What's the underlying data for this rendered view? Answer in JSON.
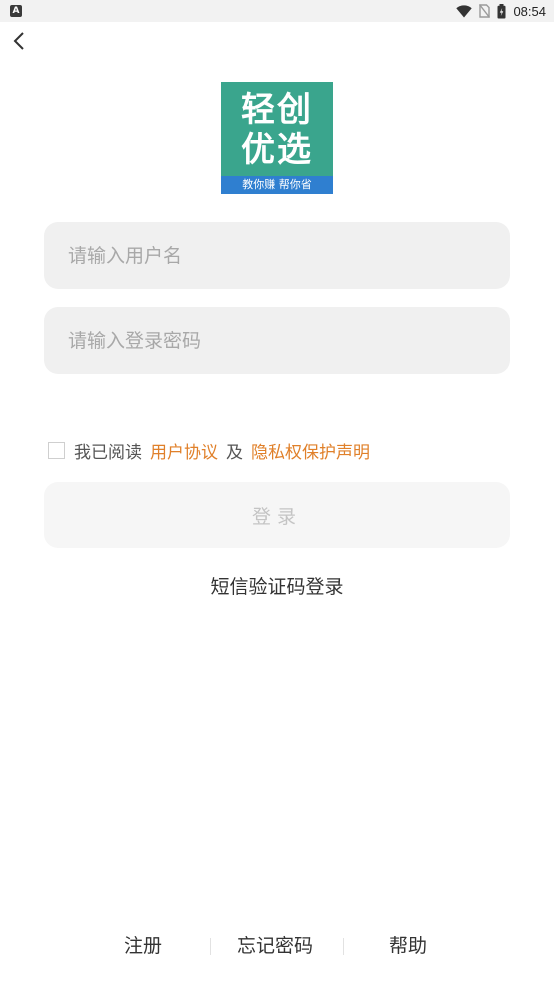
{
  "status_bar": {
    "left_icon_letter": "A",
    "time": "08:54",
    "icons": [
      "wifi-icon",
      "no-sim-icon",
      "battery-icon"
    ]
  },
  "nav": {
    "back_icon": "chevron-left-icon"
  },
  "logo": {
    "line1": "轻创",
    "line2": "优选",
    "tagline": "教你赚  帮你省",
    "colors": {
      "background": "#3aa58d",
      "tagline_background": "#2f7fd0"
    }
  },
  "form": {
    "username_placeholder": "请输入用户名",
    "username_value": "",
    "password_placeholder": "请输入登录密码",
    "password_value": "",
    "agreement": {
      "checked": false,
      "prefix": "我已阅读",
      "user_agreement": "用户协议",
      "and": "及",
      "privacy_policy": "隐私权保护声明",
      "link_color": "#e0802a"
    },
    "login_button": "登录",
    "sms_login": "短信验证码登录"
  },
  "footer": {
    "register": "注册",
    "forgot_password": "忘记密码",
    "help": "帮助"
  }
}
